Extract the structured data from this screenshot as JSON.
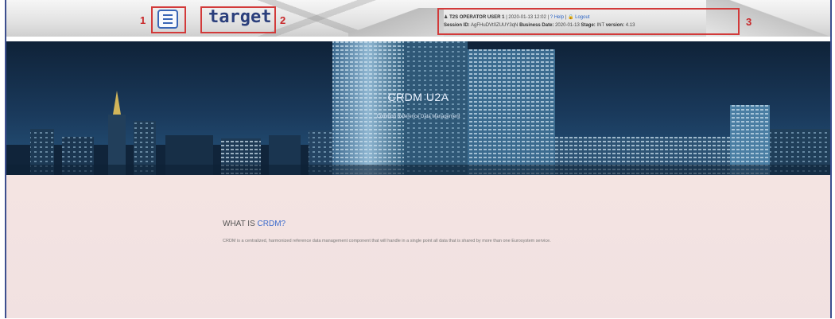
{
  "header": {
    "callouts": [
      "1",
      "2",
      "3"
    ],
    "logo_text": "target",
    "logo_sub": "",
    "user": {
      "user_label": "T2S OPERATOR USER 1",
      "datetime": "| 2020-01-13 12:02 |",
      "help_label": "Help",
      "logout_label": "Logout",
      "session_label": "Session ID:",
      "session_value": "AgFHuDVt0ZUUY3qN",
      "business_date_label": "Business Date:",
      "business_date_value": "2020-01-13",
      "stage_label": "Stage:",
      "stage_value": "INT",
      "version_label": "version:",
      "version_value": "4.13"
    }
  },
  "banner": {
    "title": "CRDM U2A",
    "subtitle": "Common Reference Data Management"
  },
  "content": {
    "heading_prefix": "WHAT IS",
    "heading_highlight": "CRDM?",
    "description": "CRDM is a centralized, harmonized reference data management component that will handle in a single point all data that is shared by more than one Eurosystem service."
  }
}
